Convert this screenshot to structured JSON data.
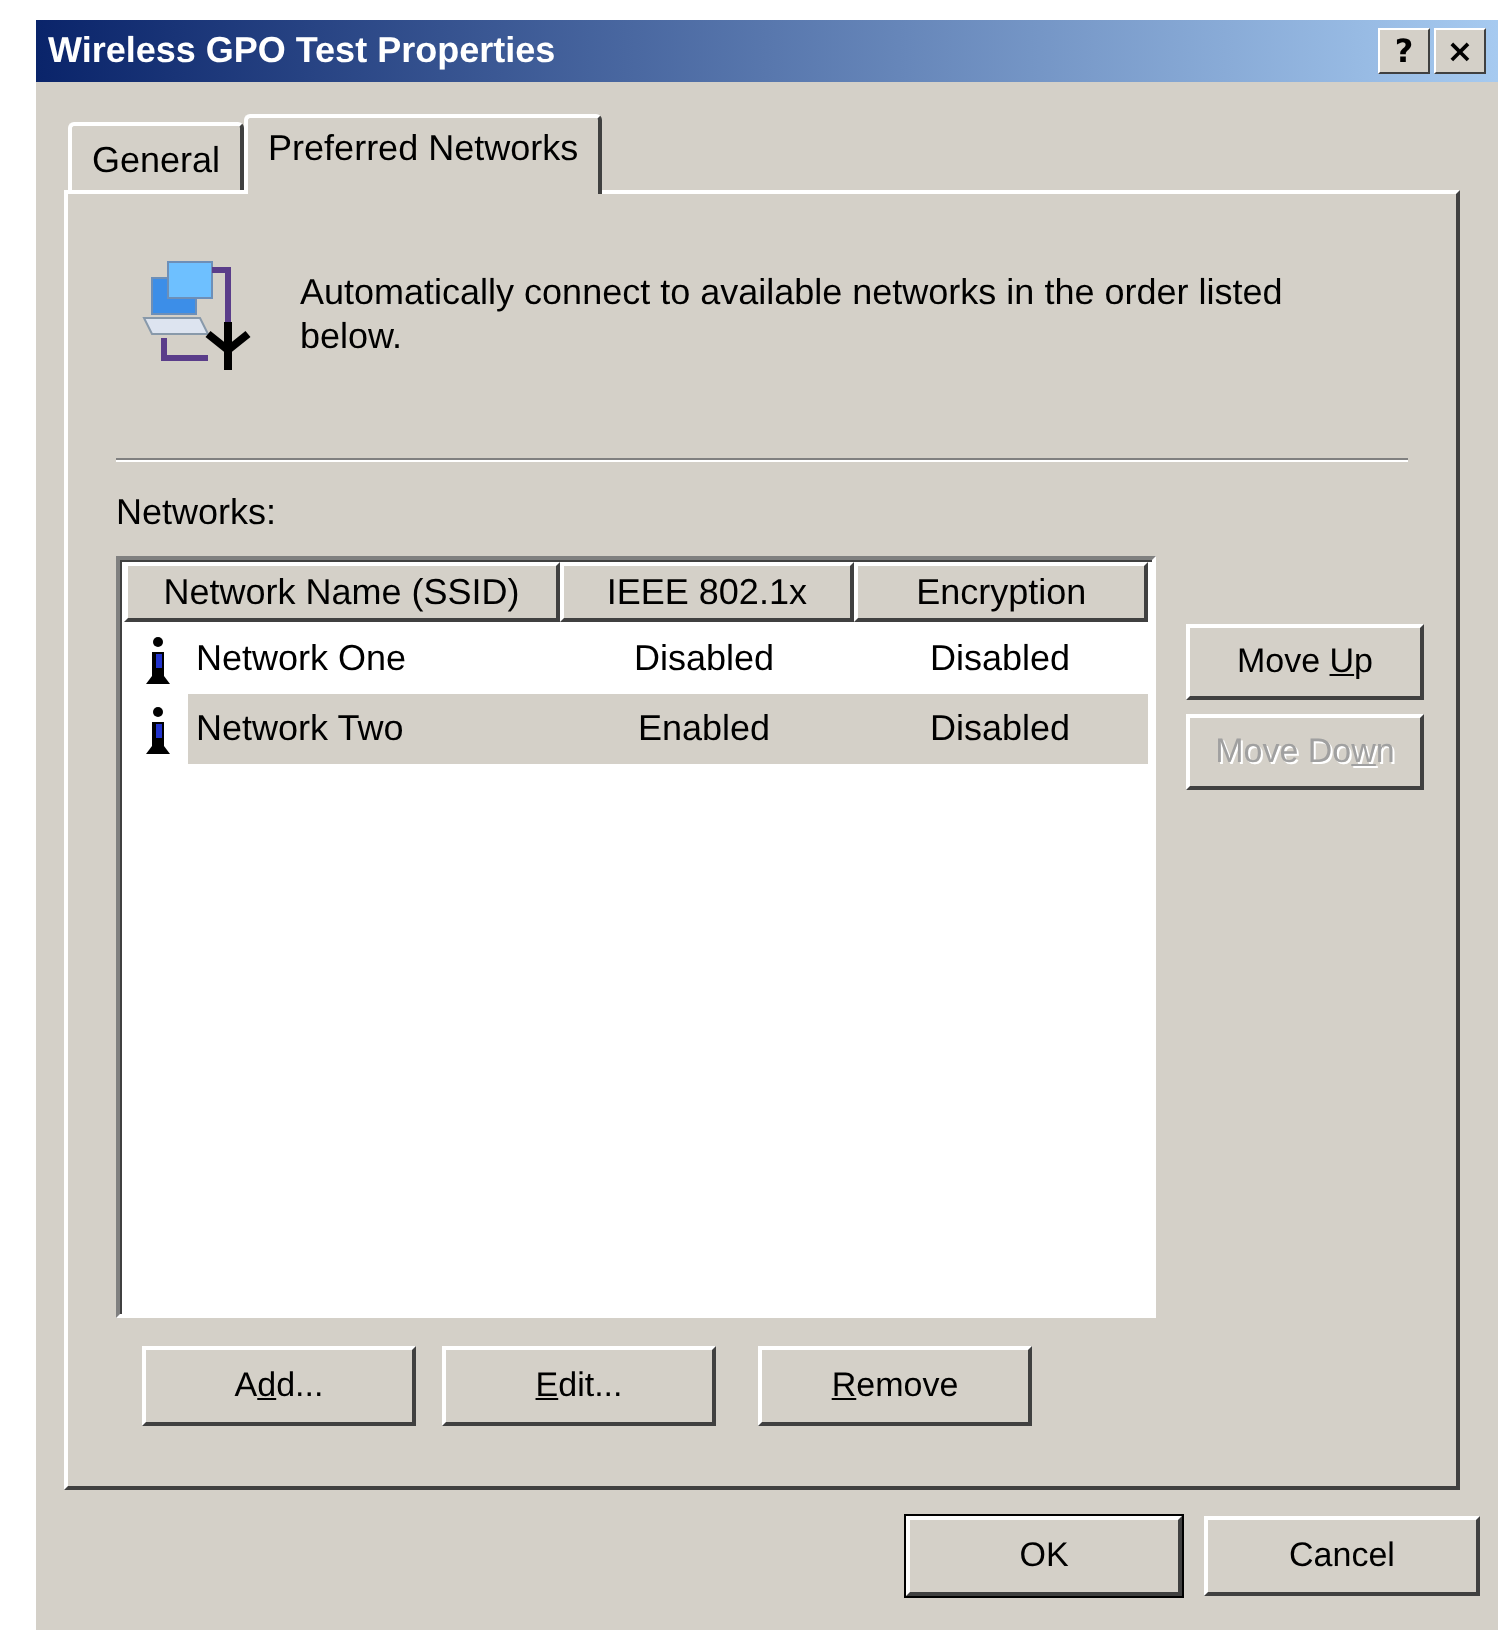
{
  "window": {
    "title": "Wireless GPO Test Properties",
    "title_buttons": [
      "?",
      "×"
    ]
  },
  "tabs": [
    {
      "label": "General",
      "selected": false
    },
    {
      "label": "Preferred Networks",
      "selected": true
    }
  ],
  "description": "Automatically connect to available networks in the order listed below.",
  "networks_label": "Networks:",
  "table": {
    "columns": [
      "Network Name (SSID)",
      "IEEE 802.1x",
      "Encryption"
    ],
    "rows": [
      {
        "cells": [
          "Network One",
          "Disabled",
          "Disabled"
        ],
        "selected": false
      },
      {
        "cells": [
          "Network Two",
          "Enabled",
          "Disabled"
        ],
        "selected": true
      }
    ]
  },
  "side_buttons": [
    {
      "before": "Move ",
      "key": "U",
      "after": "p",
      "disabled": false
    },
    {
      "before": "Move Do",
      "key": "w",
      "after": "n",
      "disabled": true
    }
  ],
  "list_buttons": [
    {
      "before": "A",
      "key": "d",
      "after": "d..."
    },
    {
      "key": "E",
      "after": "dit..."
    },
    {
      "key": "R",
      "after": "emove"
    }
  ],
  "dialog_buttons": [
    {
      "label": "OK",
      "default": true
    },
    {
      "label": "Cancel",
      "default": false
    }
  ]
}
